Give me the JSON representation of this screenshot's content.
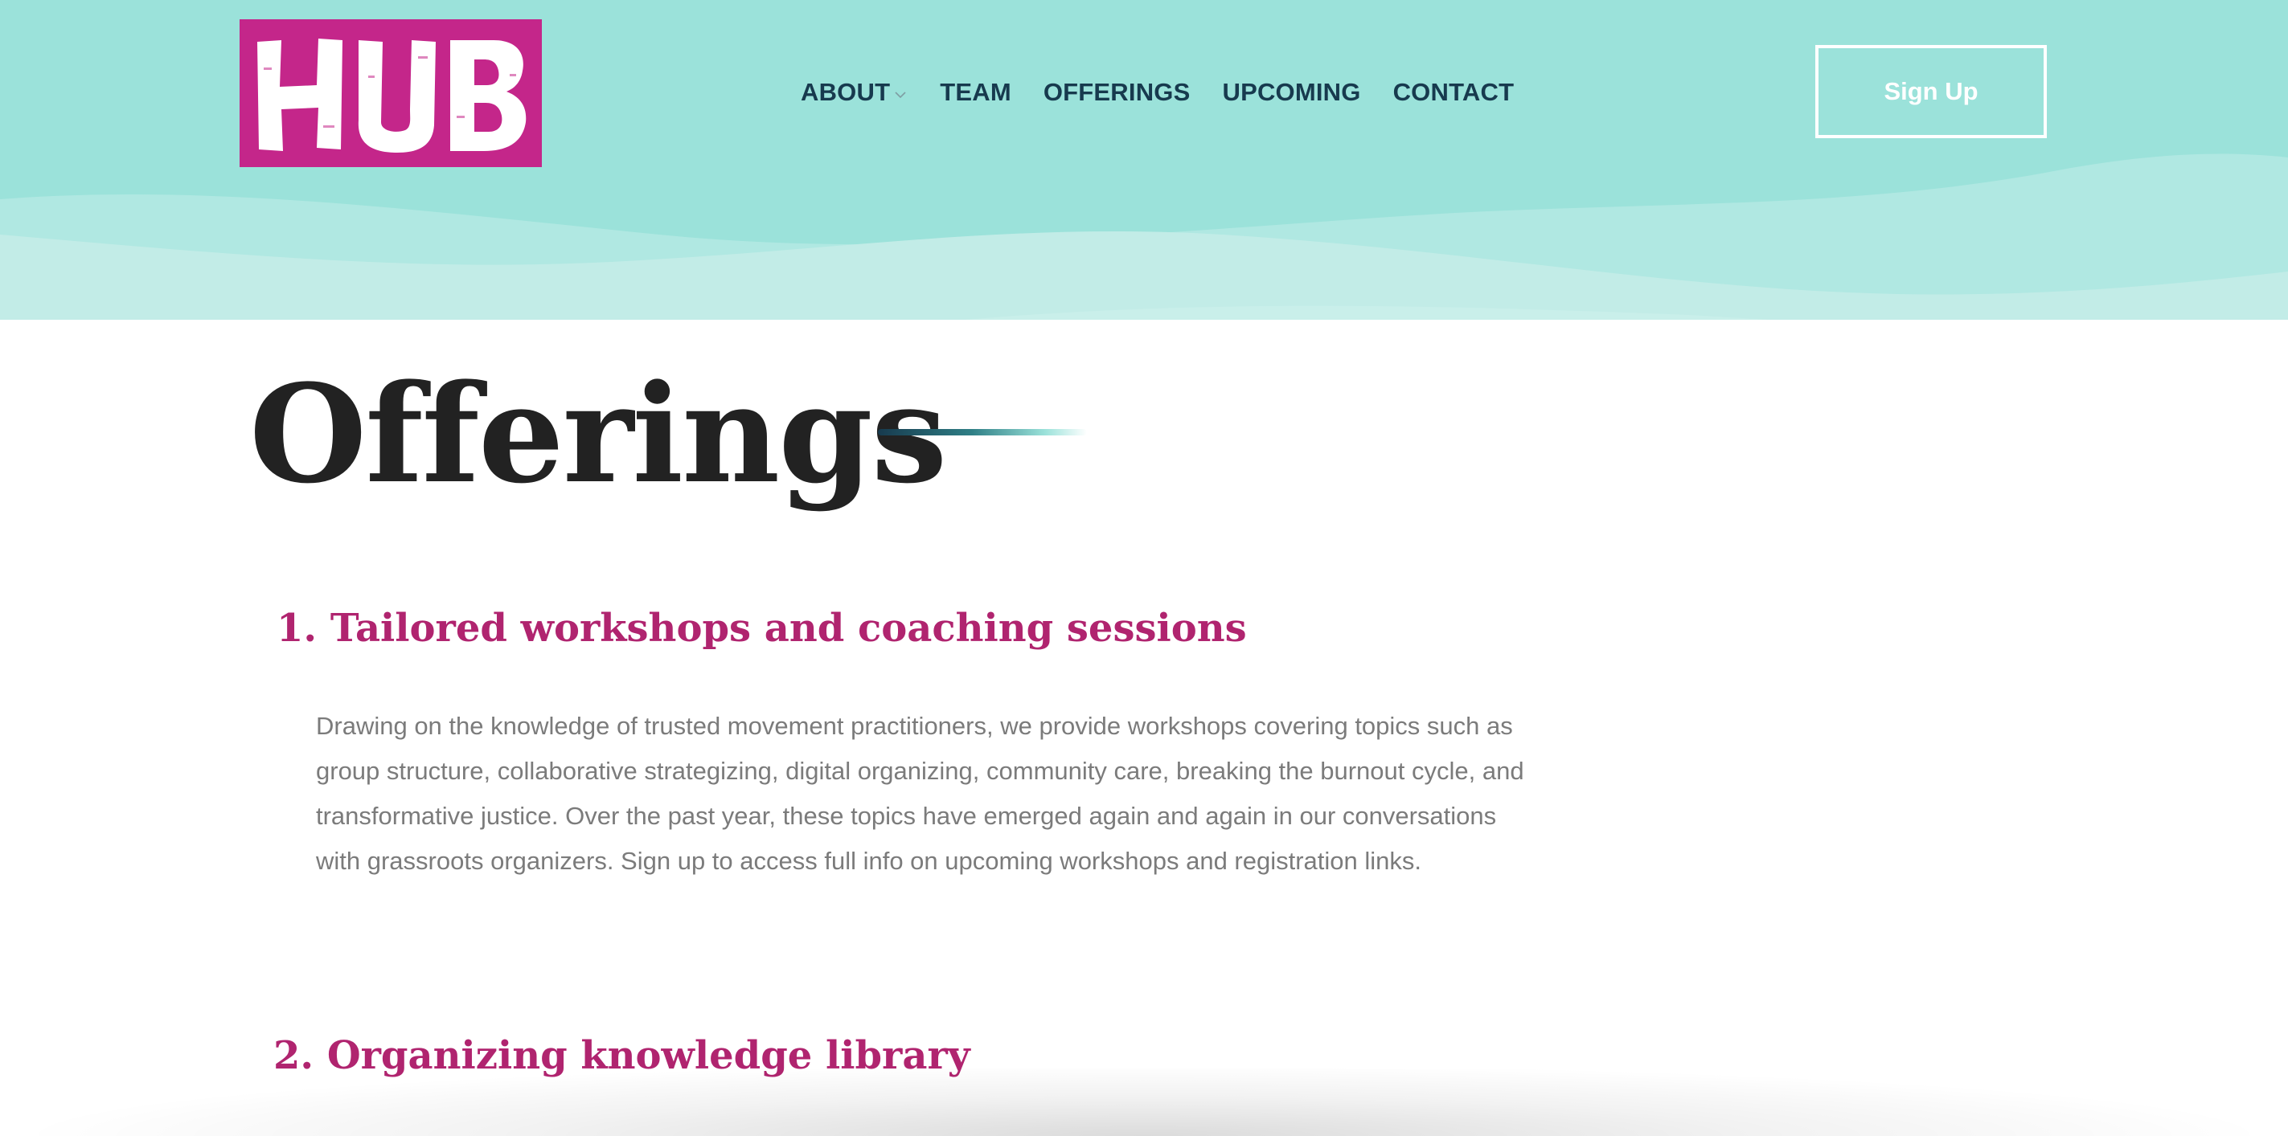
{
  "header": {
    "logo_text": "HUB",
    "nav": [
      {
        "label": "ABOUT",
        "has_dropdown": true
      },
      {
        "label": "TEAM"
      },
      {
        "label": "OFFERINGS"
      },
      {
        "label": "UPCOMING"
      },
      {
        "label": "CONTACT"
      }
    ],
    "signup_label": "Sign Up",
    "icons": {
      "dropdown": "chevron-down-icon"
    }
  },
  "main": {
    "title": "Offerings",
    "sections": [
      {
        "heading": "1. Tailored workshops and coaching sessions",
        "body": "Drawing on the knowledge of trusted movement practitioners, we provide workshops covering topics such as group structure, collaborative strategizing, digital organizing, community care, breaking the burnout cycle, and transformative justice. Over the past year, these topics have emerged again and again in our conversations with grassroots organizers. Sign up to access full info on upcoming workshops and registration links."
      },
      {
        "heading": "2. Organizing knowledge library"
      }
    ]
  },
  "colors": {
    "header_bg": "#9be2da",
    "logo_bg": "#c4268a",
    "nav_text": "#173a4e",
    "heading_accent": "#b0246f",
    "body_text": "#7b7b7b",
    "title_text": "#222222"
  }
}
